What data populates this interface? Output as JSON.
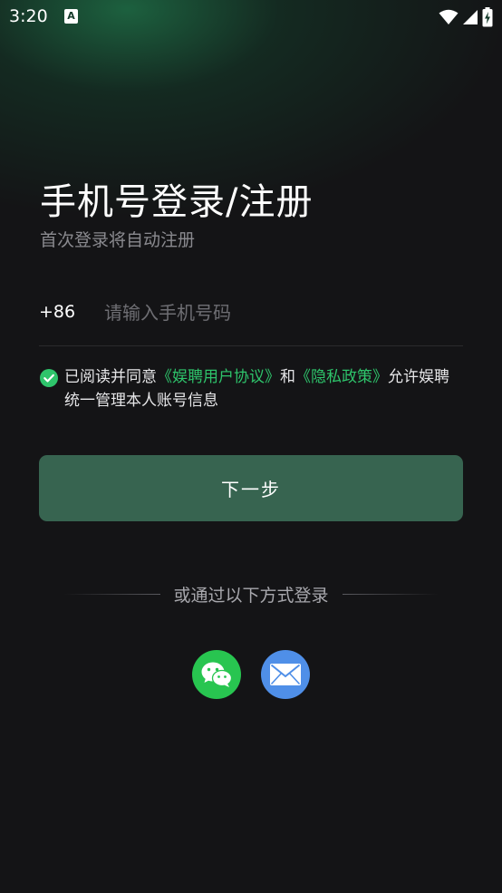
{
  "status_bar": {
    "time": "3:20",
    "a_icon_label": "A"
  },
  "login": {
    "title": "手机号登录/注册",
    "subtitle": "首次登录将自动注册",
    "country_code": "+86",
    "phone_placeholder": "请输入手机号码",
    "phone_value": "",
    "agreement": {
      "checked": true,
      "prefix": "已阅读并同意",
      "user_agreement": "《娱聘用户协议》",
      "conjunction": "和",
      "privacy_policy": "《隐私政策》",
      "suffix": "允许娱聘统一管理本人账号信息"
    },
    "next_label": "下一步",
    "alt_login_label": "或通过以下方式登录"
  },
  "colors": {
    "accent_green": "#2ec46b",
    "button_green": "#376450",
    "wechat_green": "#28c550",
    "mail_blue": "#4f8fe8"
  },
  "icons": [
    "wifi-icon",
    "signal-icon",
    "battery-icon",
    "check-circle-icon",
    "wechat-icon",
    "mail-icon"
  ]
}
